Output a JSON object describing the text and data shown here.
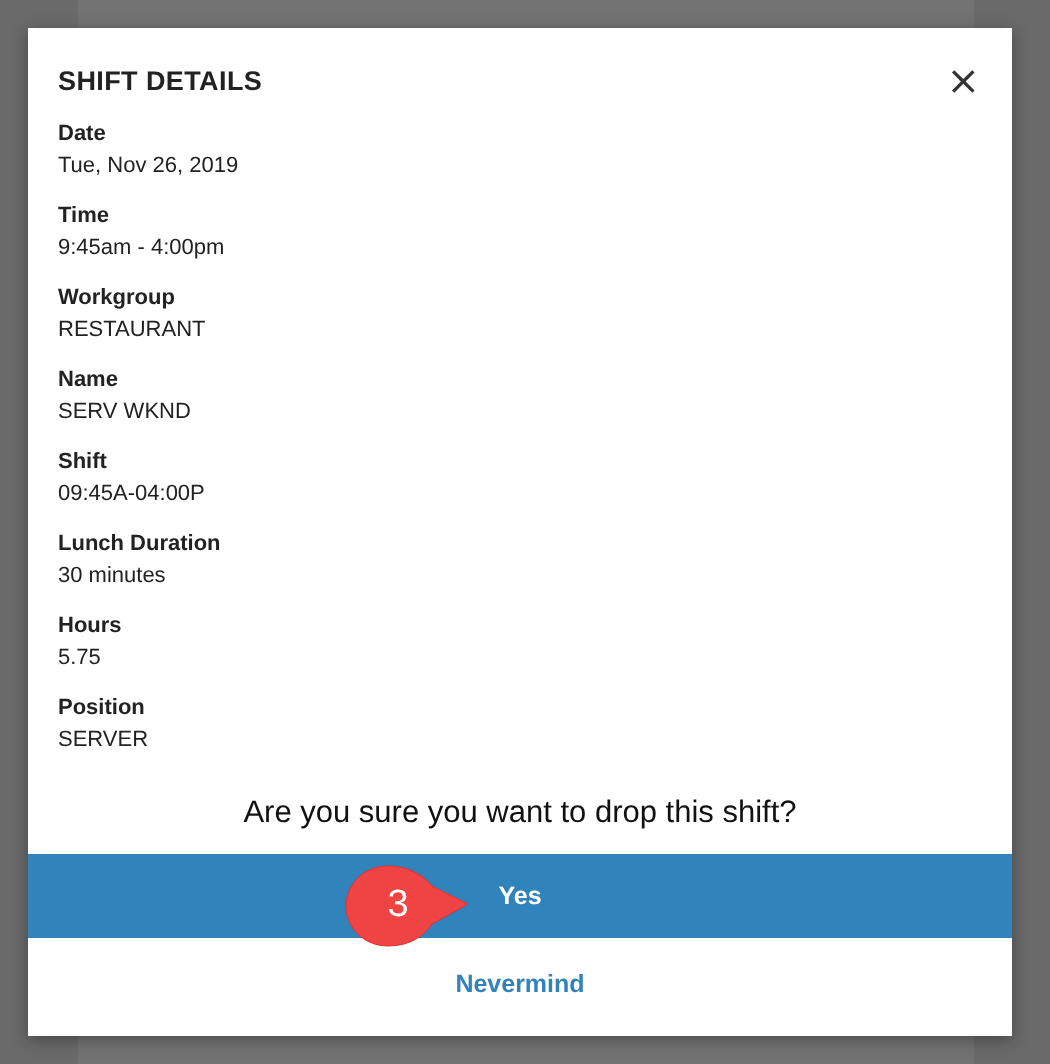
{
  "dialog": {
    "title": "SHIFT DETAILS",
    "close": "×",
    "fields": [
      {
        "label": "Date",
        "value": "Tue, Nov 26, 2019"
      },
      {
        "label": "Time",
        "value": "9:45am - 4:00pm"
      },
      {
        "label": "Workgroup",
        "value": "RESTAURANT"
      },
      {
        "label": "Name",
        "value": "SERV WKND"
      },
      {
        "label": "Shift",
        "value": "09:45A-04:00P"
      },
      {
        "label": "Lunch Duration",
        "value": "30 minutes"
      },
      {
        "label": "Hours",
        "value": "5.75"
      },
      {
        "label": "Position",
        "value": "SERVER"
      }
    ],
    "question": "Are you sure you want to drop this shift?",
    "buttons": [
      {
        "label": "Yes",
        "kind": "primary"
      },
      {
        "label": "Nevermind",
        "kind": "link"
      }
    ]
  },
  "callout": {
    "label": "3"
  }
}
